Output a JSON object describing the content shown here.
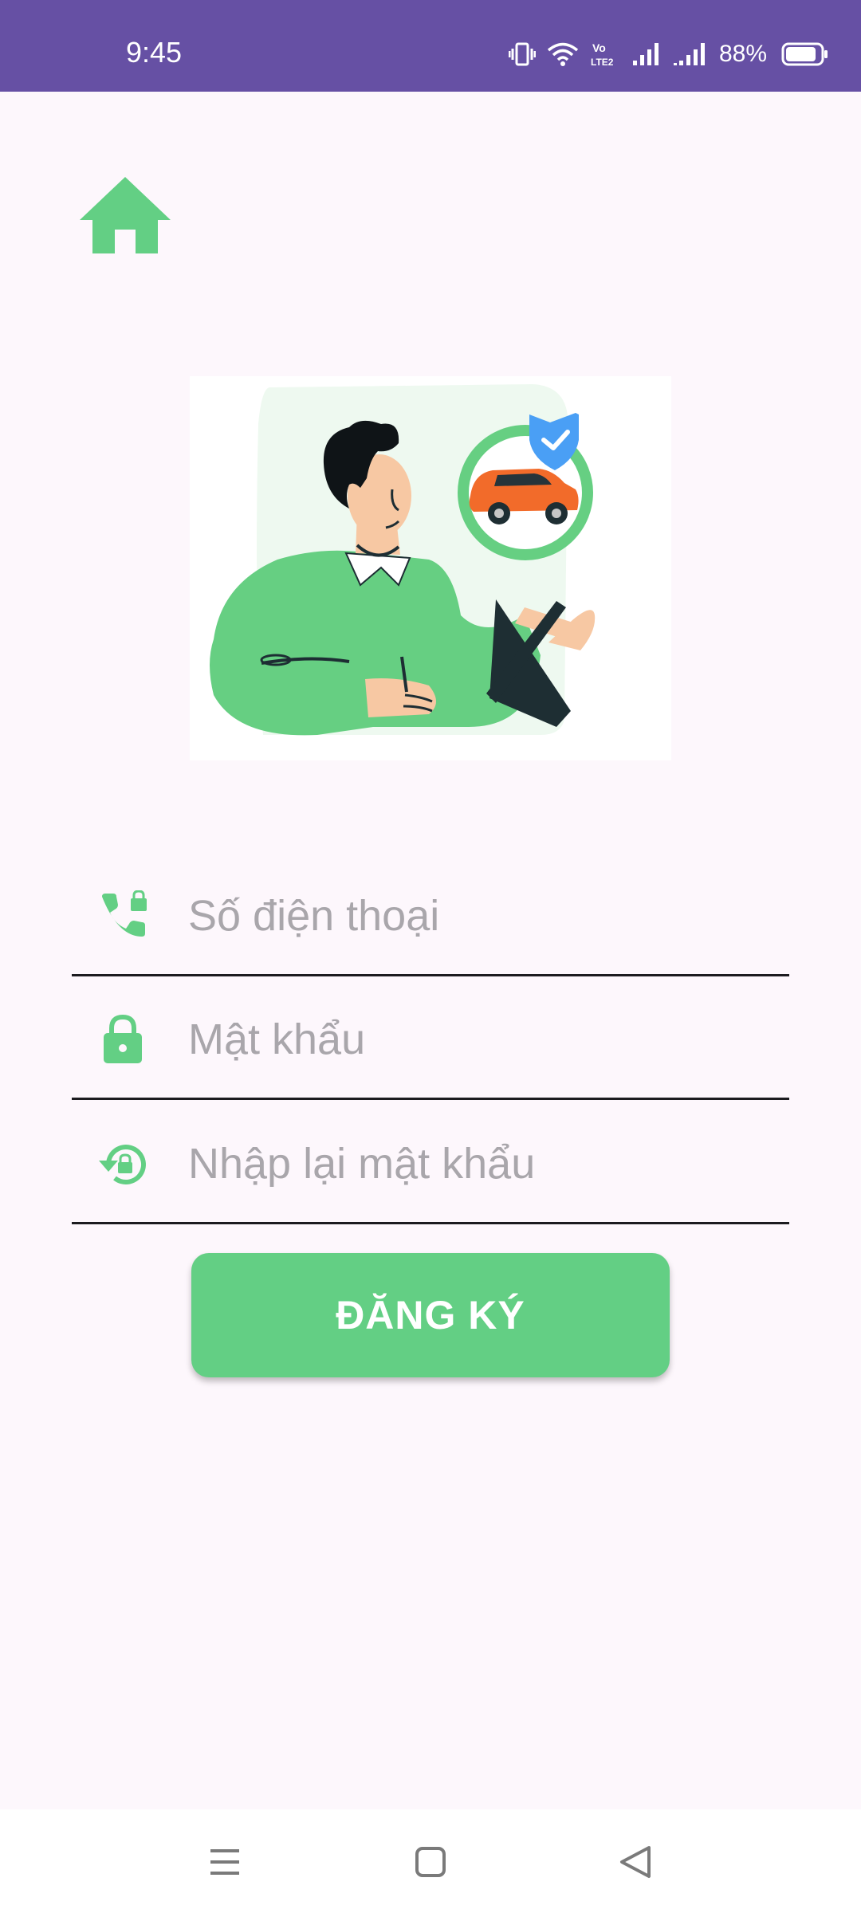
{
  "status_bar": {
    "time": "9:45",
    "network_label": "Vo LTE2",
    "battery_percent": "88%",
    "battery_level": 0.88,
    "icons": [
      "vibrate-icon",
      "wifi-icon",
      "volte-icon",
      "signal-icon",
      "signal-icon",
      "battery-icon"
    ]
  },
  "header": {
    "home_icon": "home-icon"
  },
  "form": {
    "phone": {
      "placeholder": "Số điện thoại",
      "value": "",
      "icon": "phone-lock-icon"
    },
    "password": {
      "placeholder": "Mật khẩu",
      "value": "",
      "icon": "lock-icon"
    },
    "confirm_password": {
      "placeholder": "Nhập lại mật khẩu",
      "value": "",
      "icon": "lock-reset-icon"
    },
    "submit_label": "ĐĂNG KÝ"
  },
  "nav_bar": {
    "icons": [
      "menu-icon",
      "home-square-icon",
      "back-triangle-icon"
    ]
  },
  "colors": {
    "primary": "#6650a4",
    "accent_green": "#63cf84",
    "background": "#fdf7fc",
    "placeholder": "#a9a6ab",
    "car_orange": "#f26b2a",
    "shield_blue": "#4a9ff5"
  }
}
